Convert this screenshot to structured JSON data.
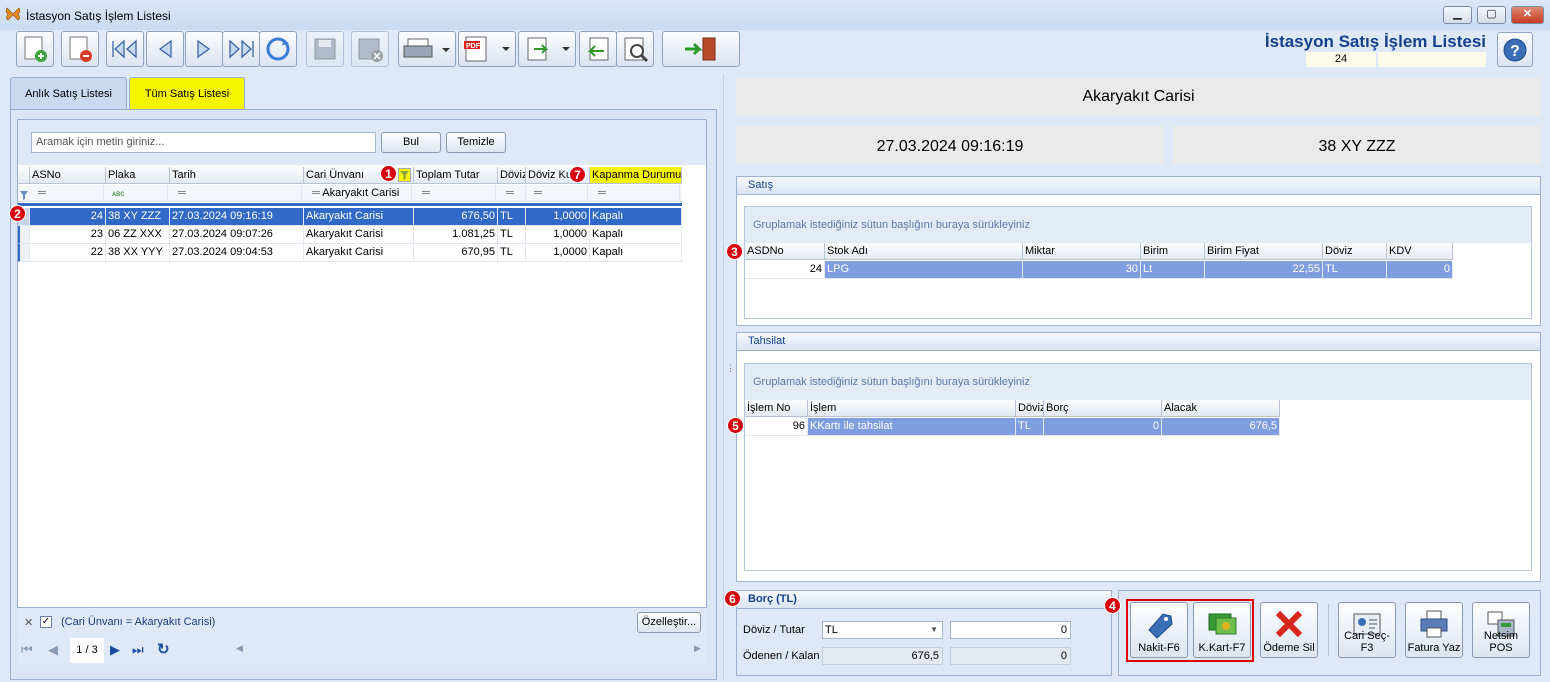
{
  "window": {
    "title": "İstasyon Satış İşlem Listesi",
    "min": "▁",
    "max": "▢",
    "close": "✕"
  },
  "header": {
    "title": "İstasyon Satış İşlem Listesi",
    "record_no": "24",
    "record_extra": ""
  },
  "toolbar": {
    "icons": [
      "new-icon",
      "delete-icon",
      "first-icon",
      "prev-icon",
      "next-icon",
      "last-icon",
      "refresh-icon",
      "save-icon",
      "cancel-icon",
      "print-icon",
      "pdf-icon",
      "export-icon",
      "import-icon",
      "settings-icon",
      "exit-icon"
    ]
  },
  "tabs": [
    {
      "label": "Anlık Satış Listesi"
    },
    {
      "label": "Tüm Satış Listesi"
    }
  ],
  "search": {
    "placeholder": "Aramak için metin giriniz...",
    "find": "Bul",
    "clear": "Temizle"
  },
  "grid": {
    "columns": [
      "ASNo",
      "Plaka",
      "Tarih",
      "Cari Ünvanı",
      "Toplam Tutar",
      "Döviz",
      "Döviz Kur",
      "Kapanma Durumu"
    ],
    "filter_cari": "Akaryakıt Carisi",
    "rows": [
      {
        "asno": "24",
        "plaka": "38 XY ZZZ",
        "tarih": "27.03.2024 09:16:19",
        "cari": "Akaryakıt Carisi",
        "tutar": "676,50",
        "doviz": "TL",
        "kur": "1,0000",
        "durum": "Kapalı"
      },
      {
        "asno": "23",
        "plaka": "06 ZZ XXX",
        "tarih": "27.03.2024 09:07:26",
        "cari": "Akaryakıt Carisi",
        "tutar": "1.081,25",
        "doviz": "TL",
        "kur": "1,0000",
        "durum": "Kapalı"
      },
      {
        "asno": "22",
        "plaka": "38 XX YYY",
        "tarih": "27.03.2024 09:04:53",
        "cari": "Akaryakıt Carisi",
        "tutar": "670,95",
        "doviz": "TL",
        "kur": "1,0000",
        "durum": "Kapalı"
      }
    ],
    "filter_text": "(Cari Ünvanı = Akaryakıt Carisi)",
    "customize": "Özelleştir...",
    "page": "1 / 3"
  },
  "badges": [
    "1",
    "2",
    "3",
    "4",
    "5",
    "6",
    "7"
  ],
  "right": {
    "cari": "Akaryakıt Carisi",
    "datetime": "27.03.2024 09:16:19",
    "plaka": "38 XY ZZZ",
    "satis": {
      "title": "Satış",
      "group_hint": "Gruplamak istediğiniz sütun başlığını buraya sürükleyiniz",
      "columns": [
        "ASDNo",
        "Stok Adı",
        "Miktar",
        "Birim",
        "Birim Fiyat",
        "Döviz",
        "KDV"
      ],
      "row": {
        "asdno": "24",
        "stok": "LPG",
        "miktar": "30",
        "birim": "Lt",
        "fiyat": "22,55",
        "doviz": "TL",
        "kdv": "0"
      }
    },
    "tahsilat": {
      "title": "Tahsilat",
      "group_hint": "Gruplamak istediğiniz sütun başlığını buraya sürükleyiniz",
      "columns": [
        "İşlem No",
        "İşlem",
        "Döviz",
        "Borç",
        "Alacak"
      ],
      "row": {
        "no": "96",
        "islem": "KKartı ile tahsilat",
        "doviz": "TL",
        "borc": "0",
        "alacak": "676,5"
      }
    },
    "borc": {
      "title": "Borç (TL)",
      "label1": "Döviz / Tutar",
      "label2": "Ödenen / Kalan",
      "doviz": "TL",
      "tutar": "0",
      "odenen": "676,5",
      "kalan": "0"
    },
    "buttons": [
      "Nakit-F6",
      "K.Kart-F7",
      "Ödeme Sil",
      "Cari Seç-F3",
      "Fatura Yaz",
      "Netsim POS"
    ]
  },
  "colors": {
    "accent": "#15428b",
    "selection": "#3169c6",
    "highlight": "#f5f500",
    "badge": "#d8000c"
  }
}
